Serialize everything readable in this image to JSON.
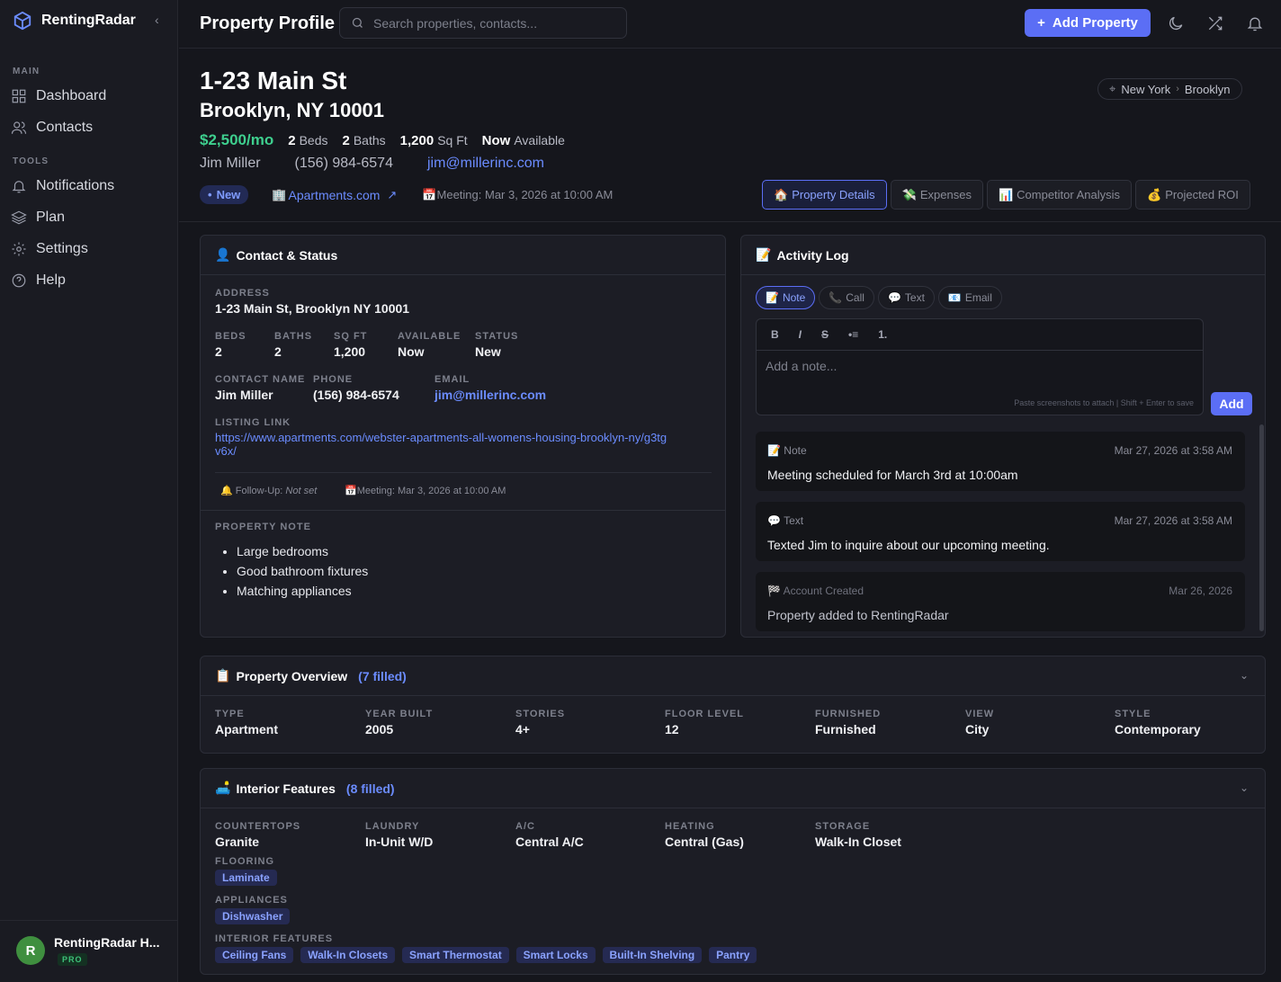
{
  "app": {
    "brand": "RentingRadar"
  },
  "sidebar": {
    "sections": [
      {
        "label": "MAIN",
        "items": [
          {
            "label": "Dashboard",
            "icon": "grid-icon"
          },
          {
            "label": "Contacts",
            "icon": "users-icon"
          }
        ]
      },
      {
        "label": "TOOLS",
        "items": [
          {
            "label": "Notifications",
            "icon": "bell-icon"
          },
          {
            "label": "Plan",
            "icon": "layers-icon"
          },
          {
            "label": "Settings",
            "icon": "gear-icon"
          },
          {
            "label": "Help",
            "icon": "help-icon"
          }
        ]
      }
    ],
    "user": {
      "initial": "R",
      "name": "RentingRadar H...",
      "plan": "PRO"
    }
  },
  "topbar": {
    "title": "Property Profile",
    "search_placeholder": "Search properties, contacts...",
    "add_label": "Add Property"
  },
  "property": {
    "address_line1": "1-23 Main St",
    "address_line2": "Brooklyn, NY 10001",
    "price": "$2,500/mo",
    "beds": "2",
    "beds_label": "Beds",
    "baths": "2",
    "baths_label": "Baths",
    "sqft": "1,200",
    "sqft_label": "Sq Ft",
    "available": "Now",
    "available_label": "Available",
    "contact_name": "Jim Miller",
    "phone": "(156) 984-6574",
    "email": "jim@millerinc.com",
    "status": "New",
    "source": "Apartments.com",
    "meeting": "Meeting: Mar 3, 2026 at 10:00 AM",
    "breadcrumb": [
      "New York",
      "Brooklyn"
    ]
  },
  "tabs": [
    {
      "label": "Property Details",
      "emoji": "🏠",
      "active": true
    },
    {
      "label": "Expenses",
      "emoji": "💸",
      "active": false
    },
    {
      "label": "Competitor Analysis",
      "emoji": "📊",
      "active": false
    },
    {
      "label": "Projected ROI",
      "emoji": "💰",
      "active": false
    }
  ],
  "contact_card": {
    "title": "Contact & Status",
    "address_label": "ADDRESS",
    "address": "1-23 Main St, Brooklyn NY 10001",
    "beds_label": "BEDS",
    "beds": "2",
    "baths_label": "BATHS",
    "baths": "2",
    "sqft_label": "SQ FT",
    "sqft": "1,200",
    "available_label": "AVAILABLE",
    "available": "Now",
    "status_label": "STATUS",
    "status": "New",
    "name_label": "CONTACT NAME",
    "name": "Jim Miller",
    "phone_label": "PHONE",
    "phone": "(156) 984-6574",
    "email_label": "EMAIL",
    "email": "jim@millerinc.com",
    "listing_label": "LISTING LINK",
    "listing_url_1": "https://www.apartments.com/webster-apartments-all-womens-housing-brooklyn-ny/g3tg",
    "listing_url_2": "v6x/",
    "followup_label": "Follow-Up:",
    "followup_value": "Not set",
    "meeting": "Meeting: Mar 3, 2026 at 10:00 AM",
    "note_label": "PROPERTY NOTE",
    "notes": [
      "Large bedrooms",
      "Good bathroom fixtures",
      "Matching appliances"
    ]
  },
  "activity": {
    "title": "Activity Log",
    "types": [
      {
        "label": "Note",
        "emoji": "📝"
      },
      {
        "label": "Call",
        "emoji": "📞"
      },
      {
        "label": "Text",
        "emoji": "💬"
      },
      {
        "label": "Email",
        "emoji": "📧"
      }
    ],
    "toolbar": [
      "B",
      "I",
      "S",
      "•≡",
      "1."
    ],
    "placeholder": "Add a note...",
    "hint": "Paste screenshots to attach | Shift + Enter to save",
    "add_label": "Add",
    "entries": [
      {
        "type": "Note",
        "emoji": "📝",
        "timestamp": "Mar 27, 2026 at 3:58 AM",
        "message": "Meeting scheduled for March 3rd at 10:00am"
      },
      {
        "type": "Text",
        "emoji": "💬",
        "timestamp": "Mar 27, 2026 at 3:58 AM",
        "message": "Texted Jim to inquire about our upcoming meeting."
      },
      {
        "type": "Account Created",
        "emoji": "🏁",
        "timestamp": "Mar 26, 2026",
        "message": "Property added to RentingRadar"
      }
    ]
  },
  "overview": {
    "title": "Property Overview",
    "count": "(7 filled)",
    "fields": [
      {
        "label": "TYPE",
        "value": "Apartment"
      },
      {
        "label": "YEAR BUILT",
        "value": "2005"
      },
      {
        "label": "STORIES",
        "value": "4+"
      },
      {
        "label": "FLOOR LEVEL",
        "value": "12"
      },
      {
        "label": "FURNISHED",
        "value": "Furnished"
      },
      {
        "label": "VIEW",
        "value": "City"
      },
      {
        "label": "STYLE",
        "value": "Contemporary"
      }
    ]
  },
  "interior": {
    "title": "Interior Features",
    "count": "(8 filled)",
    "fields": [
      {
        "label": "COUNTERTOPS",
        "value": "Granite"
      },
      {
        "label": "LAUNDRY",
        "value": "In-Unit W/D"
      },
      {
        "label": "A/C",
        "value": "Central A/C"
      },
      {
        "label": "HEATING",
        "value": "Central (Gas)"
      },
      {
        "label": "STORAGE",
        "value": "Walk-In Closet"
      }
    ],
    "flooring_label": "FLOORING",
    "flooring": [
      "Laminate"
    ],
    "appliances_label": "APPLIANCES",
    "appliances": [
      "Dishwasher"
    ],
    "features_label": "INTERIOR FEATURES",
    "features": [
      "Ceiling Fans",
      "Walk-In Closets",
      "Smart Thermostat",
      "Smart Locks",
      "Built-In Shelving",
      "Pantry"
    ]
  }
}
